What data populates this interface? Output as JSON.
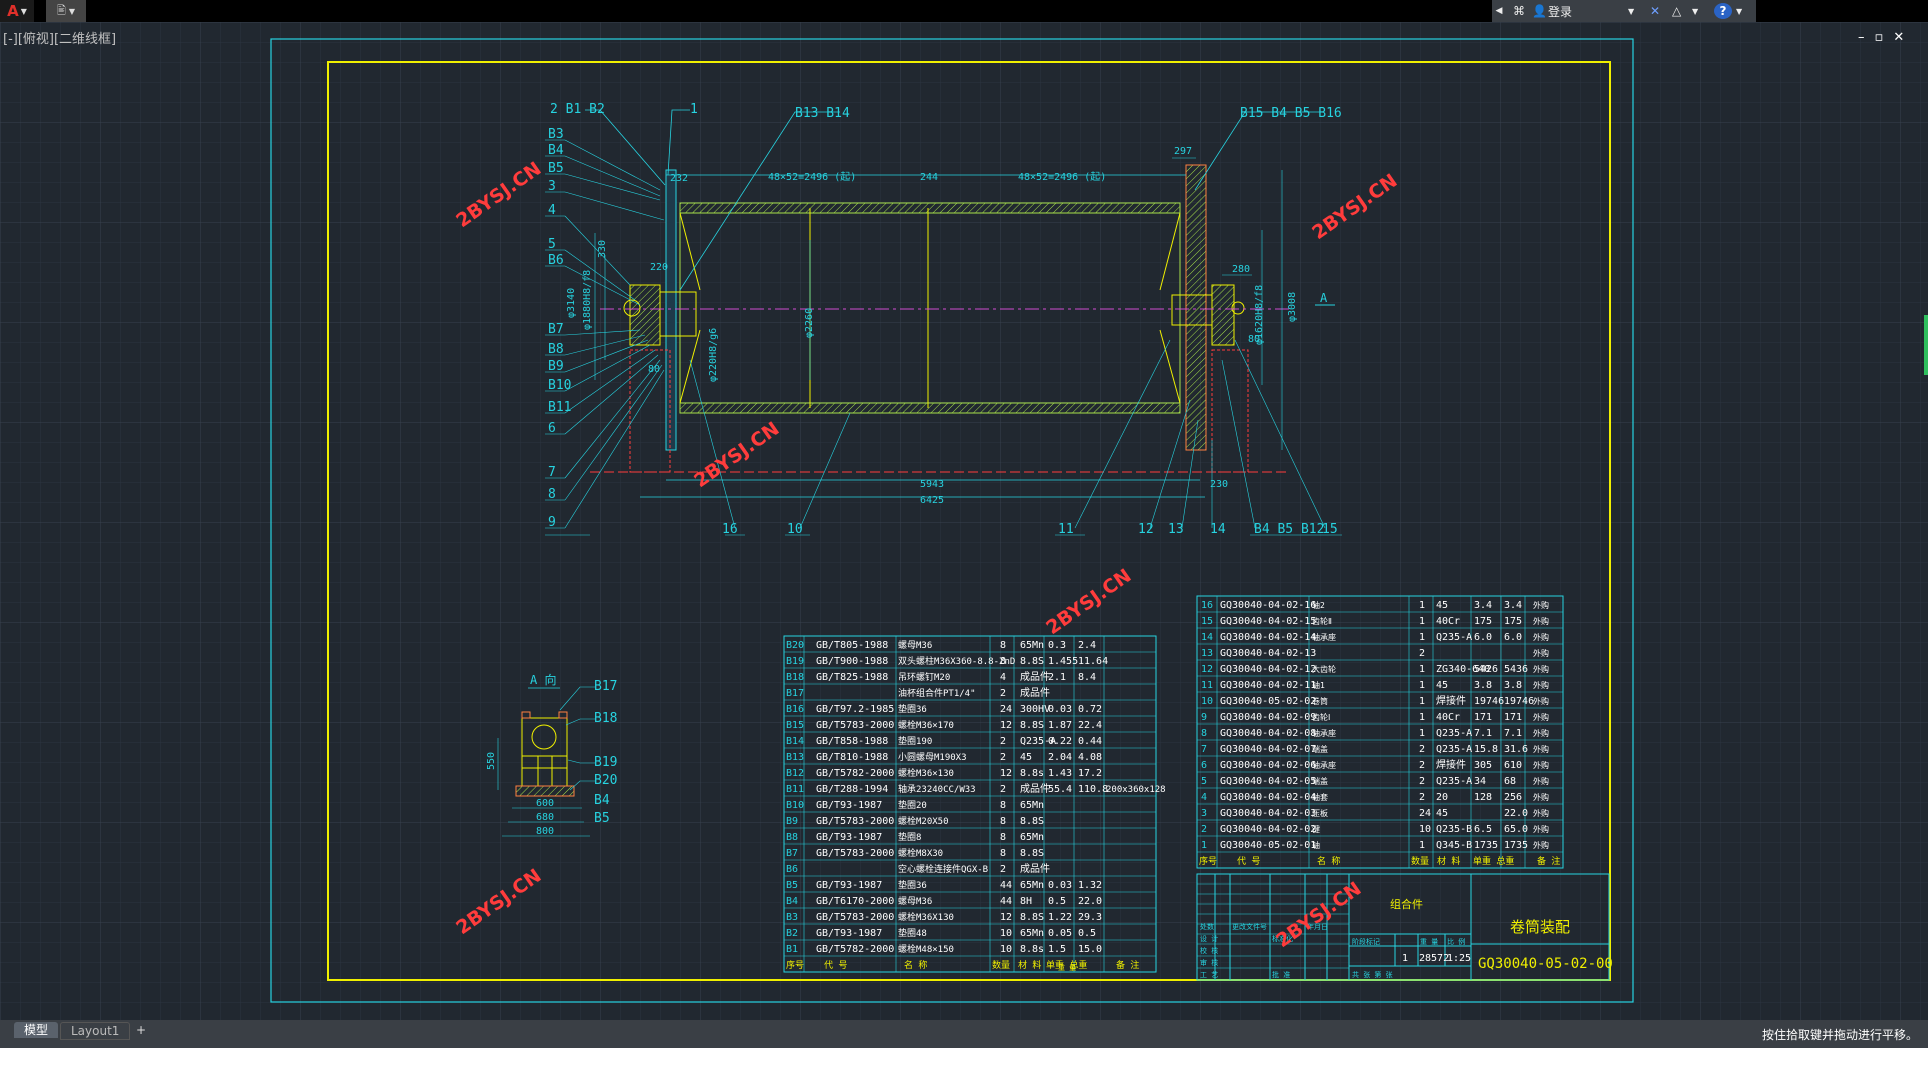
{
  "titlebar": {
    "logo": "A",
    "user": "登录",
    "help": "?"
  },
  "viewport": {
    "label": "[-][俯视][二维线框]",
    "controls": [
      "–",
      "▫",
      "✕"
    ]
  },
  "layout_tabs": [
    {
      "label": "模型",
      "active": true
    },
    {
      "label": "Layout1",
      "active": false
    },
    {
      "label": "+",
      "active": false
    }
  ],
  "status_text": "按住拾取键并拖动进行平移。",
  "watermark": "2BYSJ.CN",
  "drawing": {
    "section_label": "A 向",
    "view_arrow": "A",
    "dimensions": {
      "d232": "232",
      "d4852a": "48×52=2496 (起)",
      "d244": "244",
      "d4852b": "48×52=2496 (起)",
      "d297": "297",
      "d220": "220",
      "d280": "280",
      "d5943": "5943",
      "d6425": "6425",
      "d230": "230",
      "d80a": "80",
      "d80b": "80",
      "d550": "550",
      "d600": "600",
      "d680": "680",
      "d800": "800",
      "phi2260": "φ2260",
      "phi3140": "φ3140",
      "phi1880": "φ1880H8/f8",
      "phi220": "φ220H8/g6",
      "phi1620": "φ1620H8/f8",
      "phi3008": "φ3008",
      "d330": "330"
    },
    "balloons_left": [
      "B3",
      "B4",
      "B5",
      "3",
      "4",
      "5",
      "B6",
      "B7",
      "B8",
      "B9",
      "B10",
      "B11",
      "6",
      "7",
      "8",
      "9"
    ],
    "balloons_top": [
      "2  B1  B2",
      "1",
      "B13 B14",
      "B15 B4 B5 B16"
    ],
    "balloons_bottom": [
      "16",
      "10",
      "11",
      "12",
      "13",
      "14",
      "B4 B5 B12",
      "15"
    ],
    "balloons_section": [
      "B17",
      "B18",
      "B19",
      "B20",
      "B4",
      "B5"
    ]
  },
  "bom_left": {
    "header": [
      "序号",
      "代 号",
      "名 称",
      "数量",
      "材 料",
      "单重 总重",
      "备 注"
    ],
    "header_sub": "重 量",
    "rows": [
      [
        "B20",
        "GB/T805-1988",
        "螺母M36",
        "8",
        "65Mn",
        "0.3",
        "2.4",
        ""
      ],
      [
        "B19",
        "GB/T900-1988",
        "双头螺柱M36X360-8.8-ZnD",
        "8",
        "8.8S",
        "1.455",
        "11.64",
        ""
      ],
      [
        "B18",
        "GB/T825-1988",
        "吊环螺钉M20",
        "4",
        "成品件",
        "2.1",
        "8.4",
        ""
      ],
      [
        "B17",
        "",
        "油杯组合件PT1/4\"",
        "2",
        "成品件",
        "",
        "",
        ""
      ],
      [
        "B16",
        "GB/T97.2-1985",
        "垫圈36",
        "24",
        "300HV",
        "0.03",
        "0.72",
        ""
      ],
      [
        "B15",
        "GB/T5783-2000",
        "螺栓M36×170",
        "12",
        "8.8S",
        "1.87",
        "22.4",
        ""
      ],
      [
        "B14",
        "GB/T858-1988",
        "垫圈190",
        "2",
        "Q235-A",
        "0.22",
        "0.44",
        ""
      ],
      [
        "B13",
        "GB/T810-1988",
        "小圆螺母M190X3",
        "2",
        "45",
        "2.04",
        "4.08",
        ""
      ],
      [
        "B12",
        "GB/T5782-2000",
        "螺栓M36×130",
        "12",
        "8.8s",
        "1.43",
        "17.2",
        ""
      ],
      [
        "B11",
        "GB/T288-1994",
        "轴承23240CC/W33",
        "2",
        "成品件",
        "55.4",
        "110.8",
        "200x360x128"
      ],
      [
        "B10",
        "GB/T93-1987",
        "垫圈20",
        "8",
        "65Mn",
        "",
        "",
        ""
      ],
      [
        "B9",
        "GB/T5783-2000",
        "螺栓M20X50",
        "8",
        "8.8S",
        "",
        "",
        ""
      ],
      [
        "B8",
        "GB/T93-1987",
        "垫圈8",
        "8",
        "65Mn",
        "",
        "",
        ""
      ],
      [
        "B7",
        "GB/T5783-2000",
        "螺栓M8X30",
        "8",
        "8.8S",
        "",
        "",
        ""
      ],
      [
        "B6",
        "",
        "空心螺栓连接件QGX-B",
        "2",
        "成品件",
        "",
        "",
        ""
      ],
      [
        "B5",
        "GB/T93-1987",
        "垫圈36",
        "44",
        "65Mn",
        "0.03",
        "1.32",
        ""
      ],
      [
        "B4",
        "GB/T6170-2000",
        "螺母M36",
        "44",
        "8H",
        "0.5",
        "22.0",
        ""
      ],
      [
        "B3",
        "GB/T5783-2000",
        "螺栓M36X130",
        "12",
        "8.8S",
        "1.22",
        "29.3",
        ""
      ],
      [
        "B2",
        "GB/T93-1987",
        "垫圈48",
        "10",
        "65Mn",
        "0.05",
        "0.5",
        ""
      ],
      [
        "B1",
        "GB/T5782-2000",
        "螺栓M48×150",
        "10",
        "8.8s",
        "1.5",
        "15.0",
        ""
      ]
    ]
  },
  "bom_right": {
    "header": [
      "序号",
      "代 号",
      "名 称",
      "数量",
      "材 料",
      "单重 总重",
      "备 注"
    ],
    "rows": [
      [
        "16",
        "GQ30040-04-02-16",
        "轴2",
        "1",
        "45",
        "3.4",
        "3.4",
        "外购"
      ],
      [
        "15",
        "GQ30040-04-02-15",
        "齿轮Ⅱ",
        "1",
        "40Cr",
        "175",
        "175",
        "外购"
      ],
      [
        "14",
        "GQ30040-04-02-14",
        "轴承座",
        "1",
        "Q235-A",
        "6.0",
        "6.0",
        "外购"
      ],
      [
        "13",
        "GQ30040-04-02-13",
        "",
        "2",
        "",
        "",
        "",
        "外购"
      ],
      [
        "12",
        "GQ30040-04-02-12",
        "大齿轮",
        "1",
        "ZG340-640",
        "5426",
        "5436",
        "外购"
      ],
      [
        "11",
        "GQ30040-04-02-11",
        "轴1",
        "1",
        "45",
        "3.8",
        "3.8",
        "外购"
      ],
      [
        "10",
        "GQ30040-05-02-02",
        "卷筒",
        "1",
        "焊接件",
        "19746",
        "19746",
        "外购"
      ],
      [
        "9",
        "GQ30040-04-02-09",
        "齿轮Ⅰ",
        "1",
        "40Cr",
        "171",
        "171",
        "外购"
      ],
      [
        "8",
        "GQ30040-04-02-08",
        "轴承座",
        "1",
        "Q235-A",
        "7.1",
        "7.1",
        "外购"
      ],
      [
        "7",
        "GQ30040-04-02-07",
        "端盖",
        "2",
        "Q235-A",
        "15.8",
        "31.6",
        "外购"
      ],
      [
        "6",
        "GQ30040-04-02-06",
        "轴承座",
        "2",
        "焊接件",
        "305",
        "610",
        "外购"
      ],
      [
        "5",
        "GQ30040-04-02-05",
        "端盖",
        "2",
        "Q235-A",
        "34",
        "68",
        "外购"
      ],
      [
        "4",
        "GQ30040-04-02-04",
        "轴套",
        "2",
        "20",
        "128",
        "256",
        "外购"
      ],
      [
        "3",
        "GQ30040-04-02-03",
        "压板",
        "24",
        "45",
        "",
        "22.0",
        "外购"
      ],
      [
        "2",
        "GQ30040-04-02-02",
        "键",
        "10",
        "Q235-B",
        "6.5",
        "65.0",
        "外购"
      ],
      [
        "1",
        "GQ30040-05-02-01",
        "轴",
        "1",
        "Q345-B",
        "1735",
        "1735",
        "外购"
      ]
    ]
  },
  "title_block": {
    "assembly_label": "组合件",
    "drawing_name": "卷筒装配",
    "drawing_number": "GQ30040-05-02-00",
    "weight": "28572",
    "scale": "1:25",
    "sheet": "1",
    "stage_label": "阶段标记",
    "weight_label": "重 量",
    "scale_label": "比 例",
    "rows_left": [
      "标记",
      "设 计",
      "校 核",
      "审 核",
      "工 艺",
      "批 准"
    ],
    "sign_labels": [
      "处数",
      "分区",
      "更改文件号",
      "签名",
      "年月日"
    ],
    "standard": "标准化",
    "page": "共 张  第 张"
  }
}
